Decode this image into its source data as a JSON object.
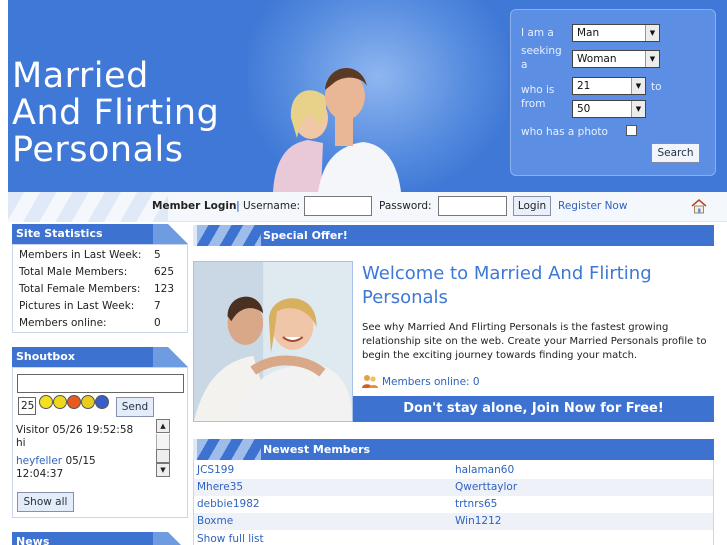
{
  "header": {
    "title_lines": [
      "Married",
      "And Flirting",
      "Personals"
    ]
  },
  "search": {
    "i_am_label": "I am a",
    "i_am_value": "Man",
    "seeking_label_1": "seeking",
    "seeking_label_2": "a",
    "seeking_value": "Woman",
    "age_label_1": "who is",
    "age_label_2": "from",
    "age_from": "21",
    "to_label": "to",
    "age_to": "50",
    "photo_label": "who has a photo",
    "button": "Search"
  },
  "login": {
    "title": "Member Login",
    "username_label": "Username:",
    "password_label": "Password:",
    "button": "Login",
    "register": "Register Now"
  },
  "site_stats": {
    "title": "Site Statistics",
    "rows": [
      {
        "label": "Members in Last Week:",
        "value": "5"
      },
      {
        "label": "Total Male Members:",
        "value": "625"
      },
      {
        "label": "Total Female Members:",
        "value": "123"
      },
      {
        "label": "Pictures in Last Week:",
        "value": "7"
      },
      {
        "label": "Members online:",
        "value": "0"
      }
    ]
  },
  "shoutbox": {
    "title": "Shoutbox",
    "counter": "25",
    "send": "Send",
    "msg1_line1": "Visitor   05/26 19:52:58",
    "msg1_line2": "hi",
    "msg2_user": "heyfeller",
    "msg2_date": "  05/15",
    "msg2_line2": "12:04:37",
    "show_all": "Show all"
  },
  "news": {
    "title": "News"
  },
  "special_offer": {
    "title": "Special Offer!",
    "welcome_title": "Welcome to Married And Flirting Personals",
    "welcome_text": "See why Married And Flirting Personals is the fastest growing relationship site on the web. Create your Married Personals profile to begin the exciting journey towards finding your match.",
    "members_online": "Members online: 0",
    "join": "Don't stay alone, Join Now for Free!"
  },
  "newest_members": {
    "title": "Newest Members",
    "rows": [
      [
        "JCS199",
        "halaman60"
      ],
      [
        "Mhere35",
        "Qwerttaylor"
      ],
      [
        "debbie1982",
        "trtnrs65"
      ],
      [
        "Boxme",
        "Win1212"
      ]
    ],
    "show_full": "Show full list"
  },
  "colors": {
    "brand_blue": "#3f78d6",
    "link_blue": "#2d62c0",
    "title_blue": "#3d78d6"
  }
}
